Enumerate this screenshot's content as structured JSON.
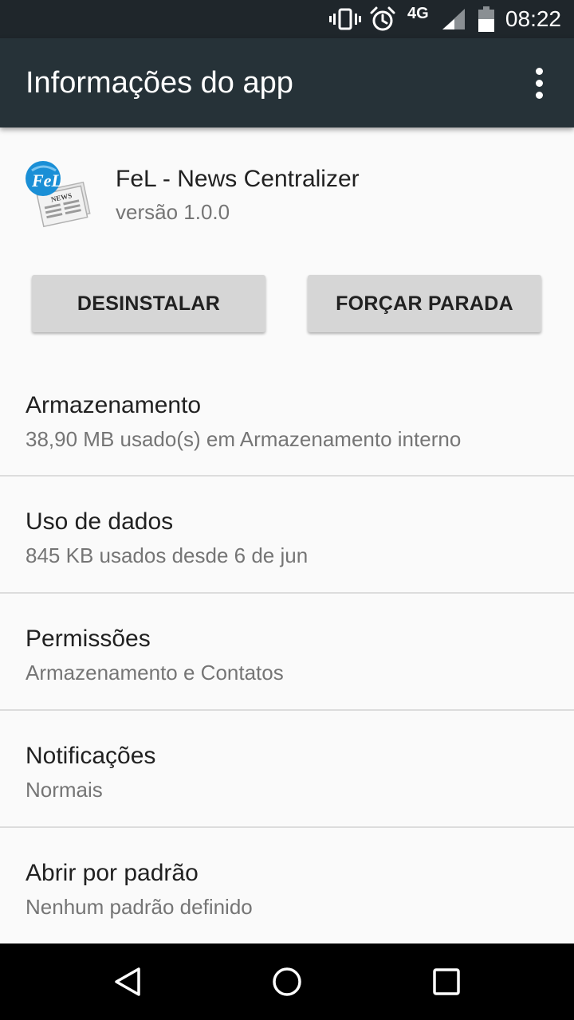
{
  "status_bar": {
    "icons": [
      "vibrate-icon",
      "alarm-icon",
      "signal-icon",
      "battery-icon"
    ],
    "network": "4G",
    "time": "08:22"
  },
  "app_bar": {
    "title": "Informações do app",
    "menu_icon": "more-vert-icon"
  },
  "app": {
    "name": "FeL - News Centralizer",
    "version": "versão 1.0.0",
    "icon_text": "NEWS"
  },
  "buttons": {
    "uninstall": "DESINSTALAR",
    "force_stop": "FORÇAR PARADA"
  },
  "settings": [
    {
      "title": "Armazenamento",
      "subtitle": "38,90 MB usado(s) em Armazenamento interno"
    },
    {
      "title": "Uso de dados",
      "subtitle": "845 KB usados desde 6 de jun"
    },
    {
      "title": "Permissões",
      "subtitle": "Armazenamento e Contatos"
    },
    {
      "title": "Notificações",
      "subtitle": "Normais"
    },
    {
      "title": "Abrir por padrão",
      "subtitle": "Nenhum padrão definido"
    }
  ],
  "nav_bar": {
    "icons": [
      "back-icon",
      "home-icon",
      "recents-icon"
    ]
  },
  "colors": {
    "status_bar": "#1f262b",
    "app_bar": "#263238",
    "background": "#fafafa",
    "button": "#d6d6d6",
    "nav_bar": "#000000"
  }
}
